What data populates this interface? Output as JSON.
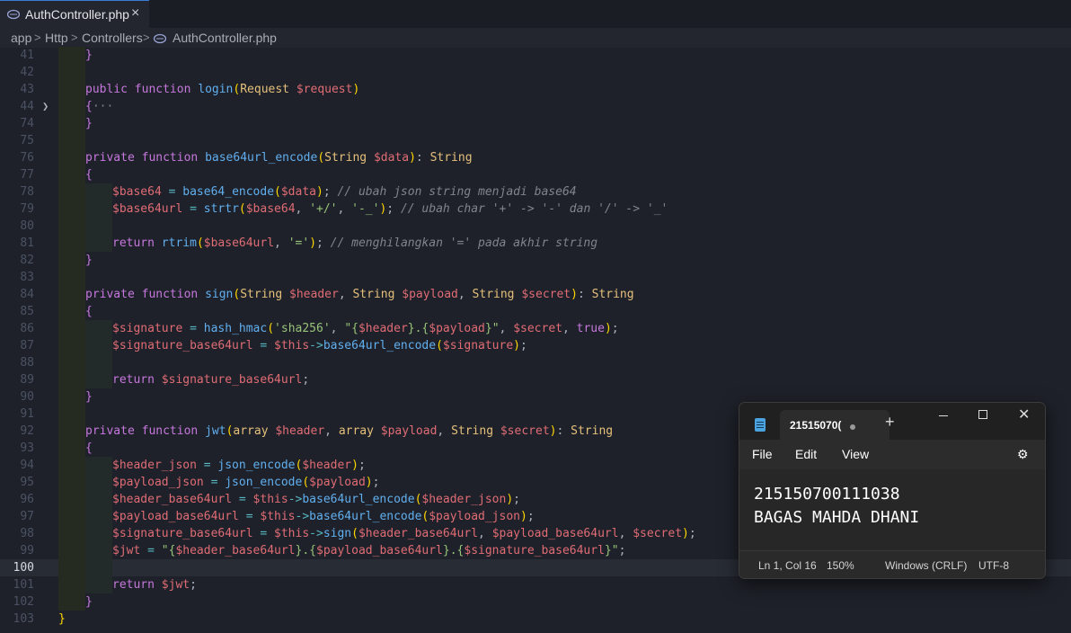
{
  "editor": {
    "tab": {
      "label": "AuthController.php",
      "close": "×"
    },
    "breadcrumb": [
      "app",
      "Http",
      "Controllers",
      "AuthController.php"
    ],
    "current_line": 100
  },
  "code_lines": [
    {
      "n": "41",
      "ind": 1,
      "parts": [
        [
          "}",
          "b"
        ]
      ]
    },
    {
      "n": "42",
      "ind": 1,
      "parts": []
    },
    {
      "n": "43",
      "ind": 1,
      "parts": [
        [
          "public ",
          "k"
        ],
        [
          "function ",
          "k"
        ],
        [
          "login",
          "f"
        ],
        [
          "(",
          "bo"
        ],
        [
          "Request ",
          "t"
        ],
        [
          "$request",
          "v"
        ],
        [
          ")",
          "bo"
        ]
      ]
    },
    {
      "n": "44",
      "ind": 1,
      "fold": true,
      "parts": [
        [
          "{",
          "b"
        ],
        [
          "···",
          "ell"
        ]
      ]
    },
    {
      "n": "74",
      "ind": 1,
      "parts": [
        [
          "}",
          "b"
        ]
      ]
    },
    {
      "n": "75",
      "ind": 1,
      "parts": []
    },
    {
      "n": "76",
      "ind": 1,
      "parts": [
        [
          "private ",
          "k"
        ],
        [
          "function ",
          "k"
        ],
        [
          "base64url_encode",
          "f"
        ],
        [
          "(",
          "bo"
        ],
        [
          "String ",
          "t"
        ],
        [
          "$data",
          "v"
        ],
        [
          ")",
          "bo"
        ],
        [
          ": ",
          "p"
        ],
        [
          "String",
          "t"
        ]
      ]
    },
    {
      "n": "77",
      "ind": 1,
      "parts": [
        [
          "{",
          "b"
        ]
      ]
    },
    {
      "n": "78",
      "ind": 2,
      "parts": [
        [
          "$base64",
          "v"
        ],
        [
          " = ",
          "o"
        ],
        [
          "base64_encode",
          "f"
        ],
        [
          "(",
          "bo"
        ],
        [
          "$data",
          "v"
        ],
        [
          ")",
          "bo"
        ],
        [
          "; ",
          "p"
        ],
        [
          "// ubah json string menjadi base64",
          "c"
        ]
      ]
    },
    {
      "n": "79",
      "ind": 2,
      "parts": [
        [
          "$base64url",
          "v"
        ],
        [
          " = ",
          "o"
        ],
        [
          "strtr",
          "f"
        ],
        [
          "(",
          "bo"
        ],
        [
          "$base64",
          "v"
        ],
        [
          ", ",
          "p"
        ],
        [
          "'+/'",
          "s"
        ],
        [
          ", ",
          "p"
        ],
        [
          "'-_'",
          "s"
        ],
        [
          ")",
          "bo"
        ],
        [
          "; ",
          "p"
        ],
        [
          "// ubah char '+' -> '-' dan '/' -> '_'",
          "c"
        ]
      ]
    },
    {
      "n": "80",
      "ind": 2,
      "parts": []
    },
    {
      "n": "81",
      "ind": 2,
      "parts": [
        [
          "return ",
          "k"
        ],
        [
          "rtrim",
          "f"
        ],
        [
          "(",
          "bo"
        ],
        [
          "$base64url",
          "v"
        ],
        [
          ", ",
          "p"
        ],
        [
          "'='",
          "s"
        ],
        [
          ")",
          "bo"
        ],
        [
          "; ",
          "p"
        ],
        [
          "// menghilangkan '=' pada akhir string",
          "c"
        ]
      ]
    },
    {
      "n": "82",
      "ind": 1,
      "parts": [
        [
          "}",
          "b"
        ]
      ]
    },
    {
      "n": "83",
      "ind": 1,
      "parts": []
    },
    {
      "n": "84",
      "ind": 1,
      "parts": [
        [
          "private ",
          "k"
        ],
        [
          "function ",
          "k"
        ],
        [
          "sign",
          "f"
        ],
        [
          "(",
          "bo"
        ],
        [
          "String ",
          "t"
        ],
        [
          "$header",
          "v"
        ],
        [
          ", ",
          "p"
        ],
        [
          "String ",
          "t"
        ],
        [
          "$payload",
          "v"
        ],
        [
          ", ",
          "p"
        ],
        [
          "String ",
          "t"
        ],
        [
          "$secret",
          "v"
        ],
        [
          ")",
          "bo"
        ],
        [
          ": ",
          "p"
        ],
        [
          "String",
          "t"
        ]
      ]
    },
    {
      "n": "85",
      "ind": 1,
      "parts": [
        [
          "{",
          "b"
        ]
      ]
    },
    {
      "n": "86",
      "ind": 2,
      "parts": [
        [
          "$signature",
          "v"
        ],
        [
          " = ",
          "o"
        ],
        [
          "hash_hmac",
          "f"
        ],
        [
          "(",
          "bo"
        ],
        [
          "'sha256'",
          "s"
        ],
        [
          ", ",
          "p"
        ],
        [
          "\"{",
          "s"
        ],
        [
          "$header",
          "v"
        ],
        [
          "}.{",
          "s"
        ],
        [
          "$payload",
          "v"
        ],
        [
          "}\"",
          "s"
        ],
        [
          ", ",
          "p"
        ],
        [
          "$secret",
          "v"
        ],
        [
          ", ",
          "p"
        ],
        [
          "true",
          "k"
        ],
        [
          ")",
          "bo"
        ],
        [
          ";",
          "p"
        ]
      ]
    },
    {
      "n": "87",
      "ind": 2,
      "parts": [
        [
          "$signature_base64url",
          "v"
        ],
        [
          " = ",
          "o"
        ],
        [
          "$this",
          "v"
        ],
        [
          "->",
          "o"
        ],
        [
          "base64url_encode",
          "f"
        ],
        [
          "(",
          "bo"
        ],
        [
          "$signature",
          "v"
        ],
        [
          ")",
          "bo"
        ],
        [
          ";",
          "p"
        ]
      ]
    },
    {
      "n": "88",
      "ind": 2,
      "parts": []
    },
    {
      "n": "89",
      "ind": 2,
      "parts": [
        [
          "return ",
          "k"
        ],
        [
          "$signature_base64url",
          "v"
        ],
        [
          ";",
          "p"
        ]
      ]
    },
    {
      "n": "90",
      "ind": 1,
      "parts": [
        [
          "}",
          "b"
        ]
      ]
    },
    {
      "n": "91",
      "ind": 1,
      "parts": []
    },
    {
      "n": "92",
      "ind": 1,
      "parts": [
        [
          "private ",
          "k"
        ],
        [
          "function ",
          "k"
        ],
        [
          "jwt",
          "f"
        ],
        [
          "(",
          "bo"
        ],
        [
          "array ",
          "t"
        ],
        [
          "$header",
          "v"
        ],
        [
          ", ",
          "p"
        ],
        [
          "array ",
          "t"
        ],
        [
          "$payload",
          "v"
        ],
        [
          ", ",
          "p"
        ],
        [
          "String ",
          "t"
        ],
        [
          "$secret",
          "v"
        ],
        [
          ")",
          "bo"
        ],
        [
          ": ",
          "p"
        ],
        [
          "String",
          "t"
        ]
      ]
    },
    {
      "n": "93",
      "ind": 1,
      "parts": [
        [
          "{",
          "b"
        ]
      ]
    },
    {
      "n": "94",
      "ind": 2,
      "parts": [
        [
          "$header_json",
          "v"
        ],
        [
          " = ",
          "o"
        ],
        [
          "json_encode",
          "f"
        ],
        [
          "(",
          "bo"
        ],
        [
          "$header",
          "v"
        ],
        [
          ")",
          "bo"
        ],
        [
          ";",
          "p"
        ]
      ]
    },
    {
      "n": "95",
      "ind": 2,
      "parts": [
        [
          "$payload_json",
          "v"
        ],
        [
          " = ",
          "o"
        ],
        [
          "json_encode",
          "f"
        ],
        [
          "(",
          "bo"
        ],
        [
          "$payload",
          "v"
        ],
        [
          ")",
          "bo"
        ],
        [
          ";",
          "p"
        ]
      ]
    },
    {
      "n": "96",
      "ind": 2,
      "parts": [
        [
          "$header_base64url",
          "v"
        ],
        [
          " = ",
          "o"
        ],
        [
          "$this",
          "v"
        ],
        [
          "->",
          "o"
        ],
        [
          "base64url_encode",
          "f"
        ],
        [
          "(",
          "bo"
        ],
        [
          "$header_json",
          "v"
        ],
        [
          ")",
          "bo"
        ],
        [
          ";",
          "p"
        ]
      ]
    },
    {
      "n": "97",
      "ind": 2,
      "parts": [
        [
          "$payload_base64url",
          "v"
        ],
        [
          " = ",
          "o"
        ],
        [
          "$this",
          "v"
        ],
        [
          "->",
          "o"
        ],
        [
          "base64url_encode",
          "f"
        ],
        [
          "(",
          "bo"
        ],
        [
          "$payload_json",
          "v"
        ],
        [
          ")",
          "bo"
        ],
        [
          ";",
          "p"
        ]
      ]
    },
    {
      "n": "98",
      "ind": 2,
      "parts": [
        [
          "$signature_base64url",
          "v"
        ],
        [
          " = ",
          "o"
        ],
        [
          "$this",
          "v"
        ],
        [
          "->",
          "o"
        ],
        [
          "sign",
          "f"
        ],
        [
          "(",
          "bo"
        ],
        [
          "$header_base64url",
          "v"
        ],
        [
          ", ",
          "p"
        ],
        [
          "$payload_base64url",
          "v"
        ],
        [
          ", ",
          "p"
        ],
        [
          "$secret",
          "v"
        ],
        [
          ")",
          "bo"
        ],
        [
          ";",
          "p"
        ]
      ]
    },
    {
      "n": "99",
      "ind": 2,
      "parts": [
        [
          "$jwt",
          "v"
        ],
        [
          " = ",
          "o"
        ],
        [
          "\"{",
          "s"
        ],
        [
          "$header_base64url",
          "v"
        ],
        [
          "}.{",
          "s"
        ],
        [
          "$payload_base64url",
          "v"
        ],
        [
          "}.{",
          "s"
        ],
        [
          "$signature_base64url",
          "v"
        ],
        [
          "}\"",
          "s"
        ],
        [
          ";",
          "p"
        ]
      ]
    },
    {
      "n": "100",
      "ind": 2,
      "parts": []
    },
    {
      "n": "101",
      "ind": 2,
      "parts": [
        [
          "return ",
          "k"
        ],
        [
          "$jwt",
          "v"
        ],
        [
          ";",
          "p"
        ]
      ]
    },
    {
      "n": "102",
      "ind": 1,
      "parts": [
        [
          "}",
          "b"
        ]
      ]
    },
    {
      "n": "103",
      "ind": 0,
      "parts": [
        [
          "}",
          "bo"
        ]
      ]
    }
  ],
  "notepad": {
    "tab_title": "21515070(",
    "new_tab": "+",
    "menu": [
      "File",
      "Edit",
      "View"
    ],
    "content": [
      "215150700111038",
      "BAGAS MAHDA DHANI"
    ],
    "status": {
      "position": "Ln 1, Col 16",
      "zoom": "150%",
      "line_ending": "Windows (CRLF)",
      "encoding": "UTF-8"
    }
  },
  "colors": {
    "keyword": "#c678dd",
    "function": "#61afef",
    "type": "#e5c07b",
    "variable": "#e06c75",
    "string": "#98c379",
    "comment": "#7f848e"
  }
}
